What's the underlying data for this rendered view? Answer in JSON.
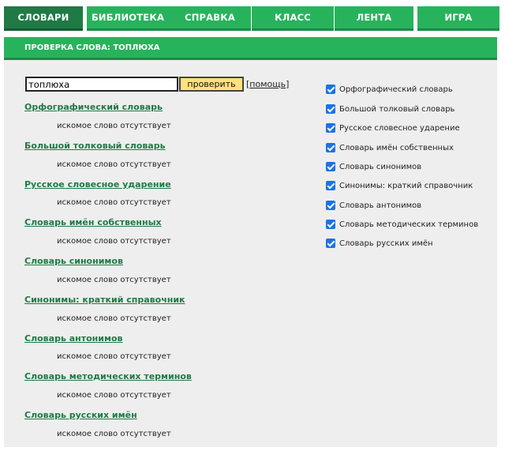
{
  "nav": {
    "tabs": [
      {
        "label": "СЛОВАРИ",
        "active": true
      },
      {
        "label": "БИБЛИОТЕКА",
        "active": false
      },
      {
        "label": "СПРАВКА",
        "active": false
      },
      {
        "label": "КЛАСС",
        "active": false
      },
      {
        "label": "ЛЕНТА",
        "active": false
      },
      {
        "label": "ИГРА",
        "active": false
      }
    ]
  },
  "panel": {
    "title": "ПРОВЕРКА СЛОВА: ТОПЛЮХА"
  },
  "search": {
    "value": "топлюха",
    "button": "проверить",
    "help": "помощь"
  },
  "results": [
    {
      "title": "Орфографический словарь",
      "message": "искомое слово отсутствует"
    },
    {
      "title": "Большой толковый словарь",
      "message": "искомое слово отсутствует"
    },
    {
      "title": "Русское словесное ударение",
      "message": "искомое слово отсутствует"
    },
    {
      "title": "Словарь имён собственных",
      "message": "искомое слово отсутствует"
    },
    {
      "title": "Словарь синонимов",
      "message": "искомое слово отсутствует"
    },
    {
      "title": "Синонимы: краткий справочник",
      "message": "искомое слово отсутствует"
    },
    {
      "title": "Словарь антонимов",
      "message": "искомое слово отсутствует"
    },
    {
      "title": "Словарь методических терминов",
      "message": "искомое слово отсутствует"
    },
    {
      "title": "Словарь русских имён",
      "message": "искомое слово отсутствует"
    }
  ],
  "dictionaries": [
    {
      "label": "Орфографический словарь",
      "checked": true
    },
    {
      "label": "Большой толковый словарь",
      "checked": true
    },
    {
      "label": "Русское словесное ударение",
      "checked": true
    },
    {
      "label": "Словарь имён собственных",
      "checked": true
    },
    {
      "label": "Словарь синонимов",
      "checked": true
    },
    {
      "label": "Синонимы: краткий справочник",
      "checked": true
    },
    {
      "label": "Словарь антонимов",
      "checked": true
    },
    {
      "label": "Словарь методических терминов",
      "checked": true
    },
    {
      "label": "Словарь русских имён",
      "checked": true
    }
  ]
}
